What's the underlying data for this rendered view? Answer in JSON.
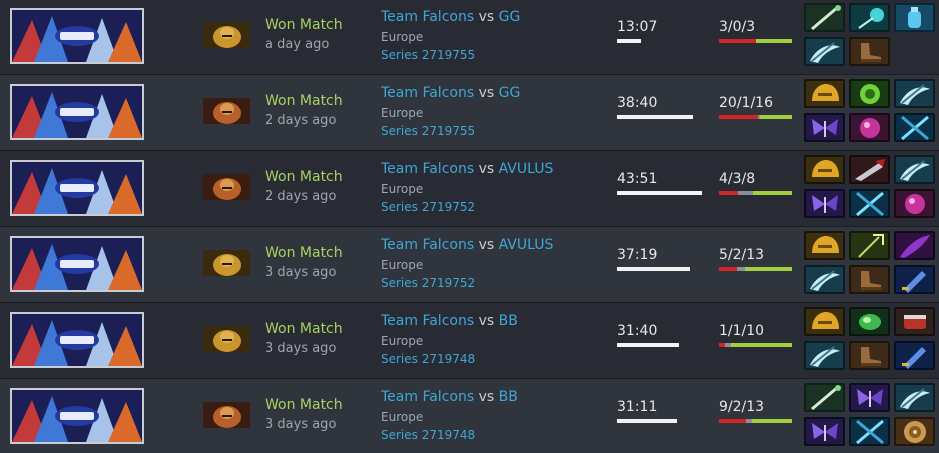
{
  "colors": {
    "win": "#a8d160",
    "link": "#3fa7d6",
    "kills": "#d32525",
    "deaths": "#8a8f97",
    "assists": "#a2cf3c"
  },
  "matches": [
    {
      "league_banner": "the-international-universe-banner",
      "hero_icon": "hero-portrait-gold",
      "result": "Won Match",
      "ago": "a day ago",
      "team": "Team Falcons",
      "vs": "vs",
      "opponent": "GG",
      "region": "Europe",
      "series": "Series 2719755",
      "duration": "13:07",
      "duration_fraction": 0.17,
      "kda": "3/0/3",
      "kills": 3,
      "deaths": 0,
      "assists": 3,
      "items": [
        "quarterstaff-icon",
        "magic-wand-icon",
        "bottle-icon",
        "battlefury-icon",
        "boots-icon"
      ]
    },
    {
      "league_banner": "the-international-universe-banner",
      "hero_icon": "hero-portrait-red",
      "result": "Won Match",
      "ago": "2 days ago",
      "team": "Team Falcons",
      "vs": "vs",
      "opponent": "GG",
      "region": "Europe",
      "series": "Series 2719755",
      "duration": "38:40",
      "duration_fraction": 0.54,
      "kda": "20/1/16",
      "kills": 20,
      "deaths": 1,
      "assists": 16,
      "items": [
        "helm-icon",
        "vortex-icon",
        "battlefury-icon",
        "butterfly-icon",
        "orb-icon",
        "manta-icon"
      ]
    },
    {
      "league_banner": "the-international-universe-banner",
      "hero_icon": "hero-portrait-red",
      "result": "Won Match",
      "ago": "2 days ago",
      "team": "Team Falcons",
      "vs": "vs",
      "opponent": "AVULUS",
      "region": "Europe",
      "series": "Series 2719752",
      "duration": "43:51",
      "duration_fraction": 0.61,
      "kda": "4/3/8",
      "kills": 4,
      "deaths": 3,
      "assists": 8,
      "items": [
        "helm-icon",
        "desolator-icon",
        "battlefury-icon",
        "butterfly-icon",
        "manta-icon",
        "orb-icon"
      ]
    },
    {
      "league_banner": "the-international-universe-banner",
      "hero_icon": "hero-portrait-gold",
      "result": "Won Match",
      "ago": "3 days ago",
      "team": "Team Falcons",
      "vs": "vs",
      "opponent": "AVULUS",
      "region": "Europe",
      "series": "Series 2719752",
      "duration": "37:19",
      "duration_fraction": 0.52,
      "kda": "5/2/13",
      "kills": 5,
      "deaths": 2,
      "assists": 13,
      "items": [
        "helm-icon",
        "trident-icon",
        "mystic-staff-icon",
        "battlefury-icon",
        "boots-icon",
        "dagger-icon"
      ]
    },
    {
      "league_banner": "the-international-universe-banner",
      "hero_icon": "hero-portrait-gold",
      "result": "Won Match",
      "ago": "3 days ago",
      "team": "Team Falcons",
      "vs": "vs",
      "opponent": "BB",
      "region": "Europe",
      "series": "Series 2719748",
      "duration": "31:40",
      "duration_fraction": 0.44,
      "kda": "1/1/10",
      "kills": 1,
      "deaths": 1,
      "assists": 10,
      "items": [
        "helm-icon",
        "green-orb-icon",
        "gauntlet-icon",
        "battlefury-icon",
        "boots-icon",
        "dagger-icon"
      ]
    },
    {
      "league_banner": "the-international-universe-banner",
      "hero_icon": "hero-portrait-red",
      "result": "Won Match",
      "ago": "3 days ago",
      "team": "Team Falcons",
      "vs": "vs",
      "opponent": "BB",
      "region": "Europe",
      "series": "Series 2719748",
      "duration": "31:11",
      "duration_fraction": 0.43,
      "kda": "9/2/13",
      "kills": 9,
      "deaths": 2,
      "assists": 13,
      "items": [
        "quarterstaff-icon",
        "butterfly-icon",
        "battlefury-icon",
        "butterfly-icon",
        "manta-icon",
        "shield-icon"
      ]
    }
  ]
}
